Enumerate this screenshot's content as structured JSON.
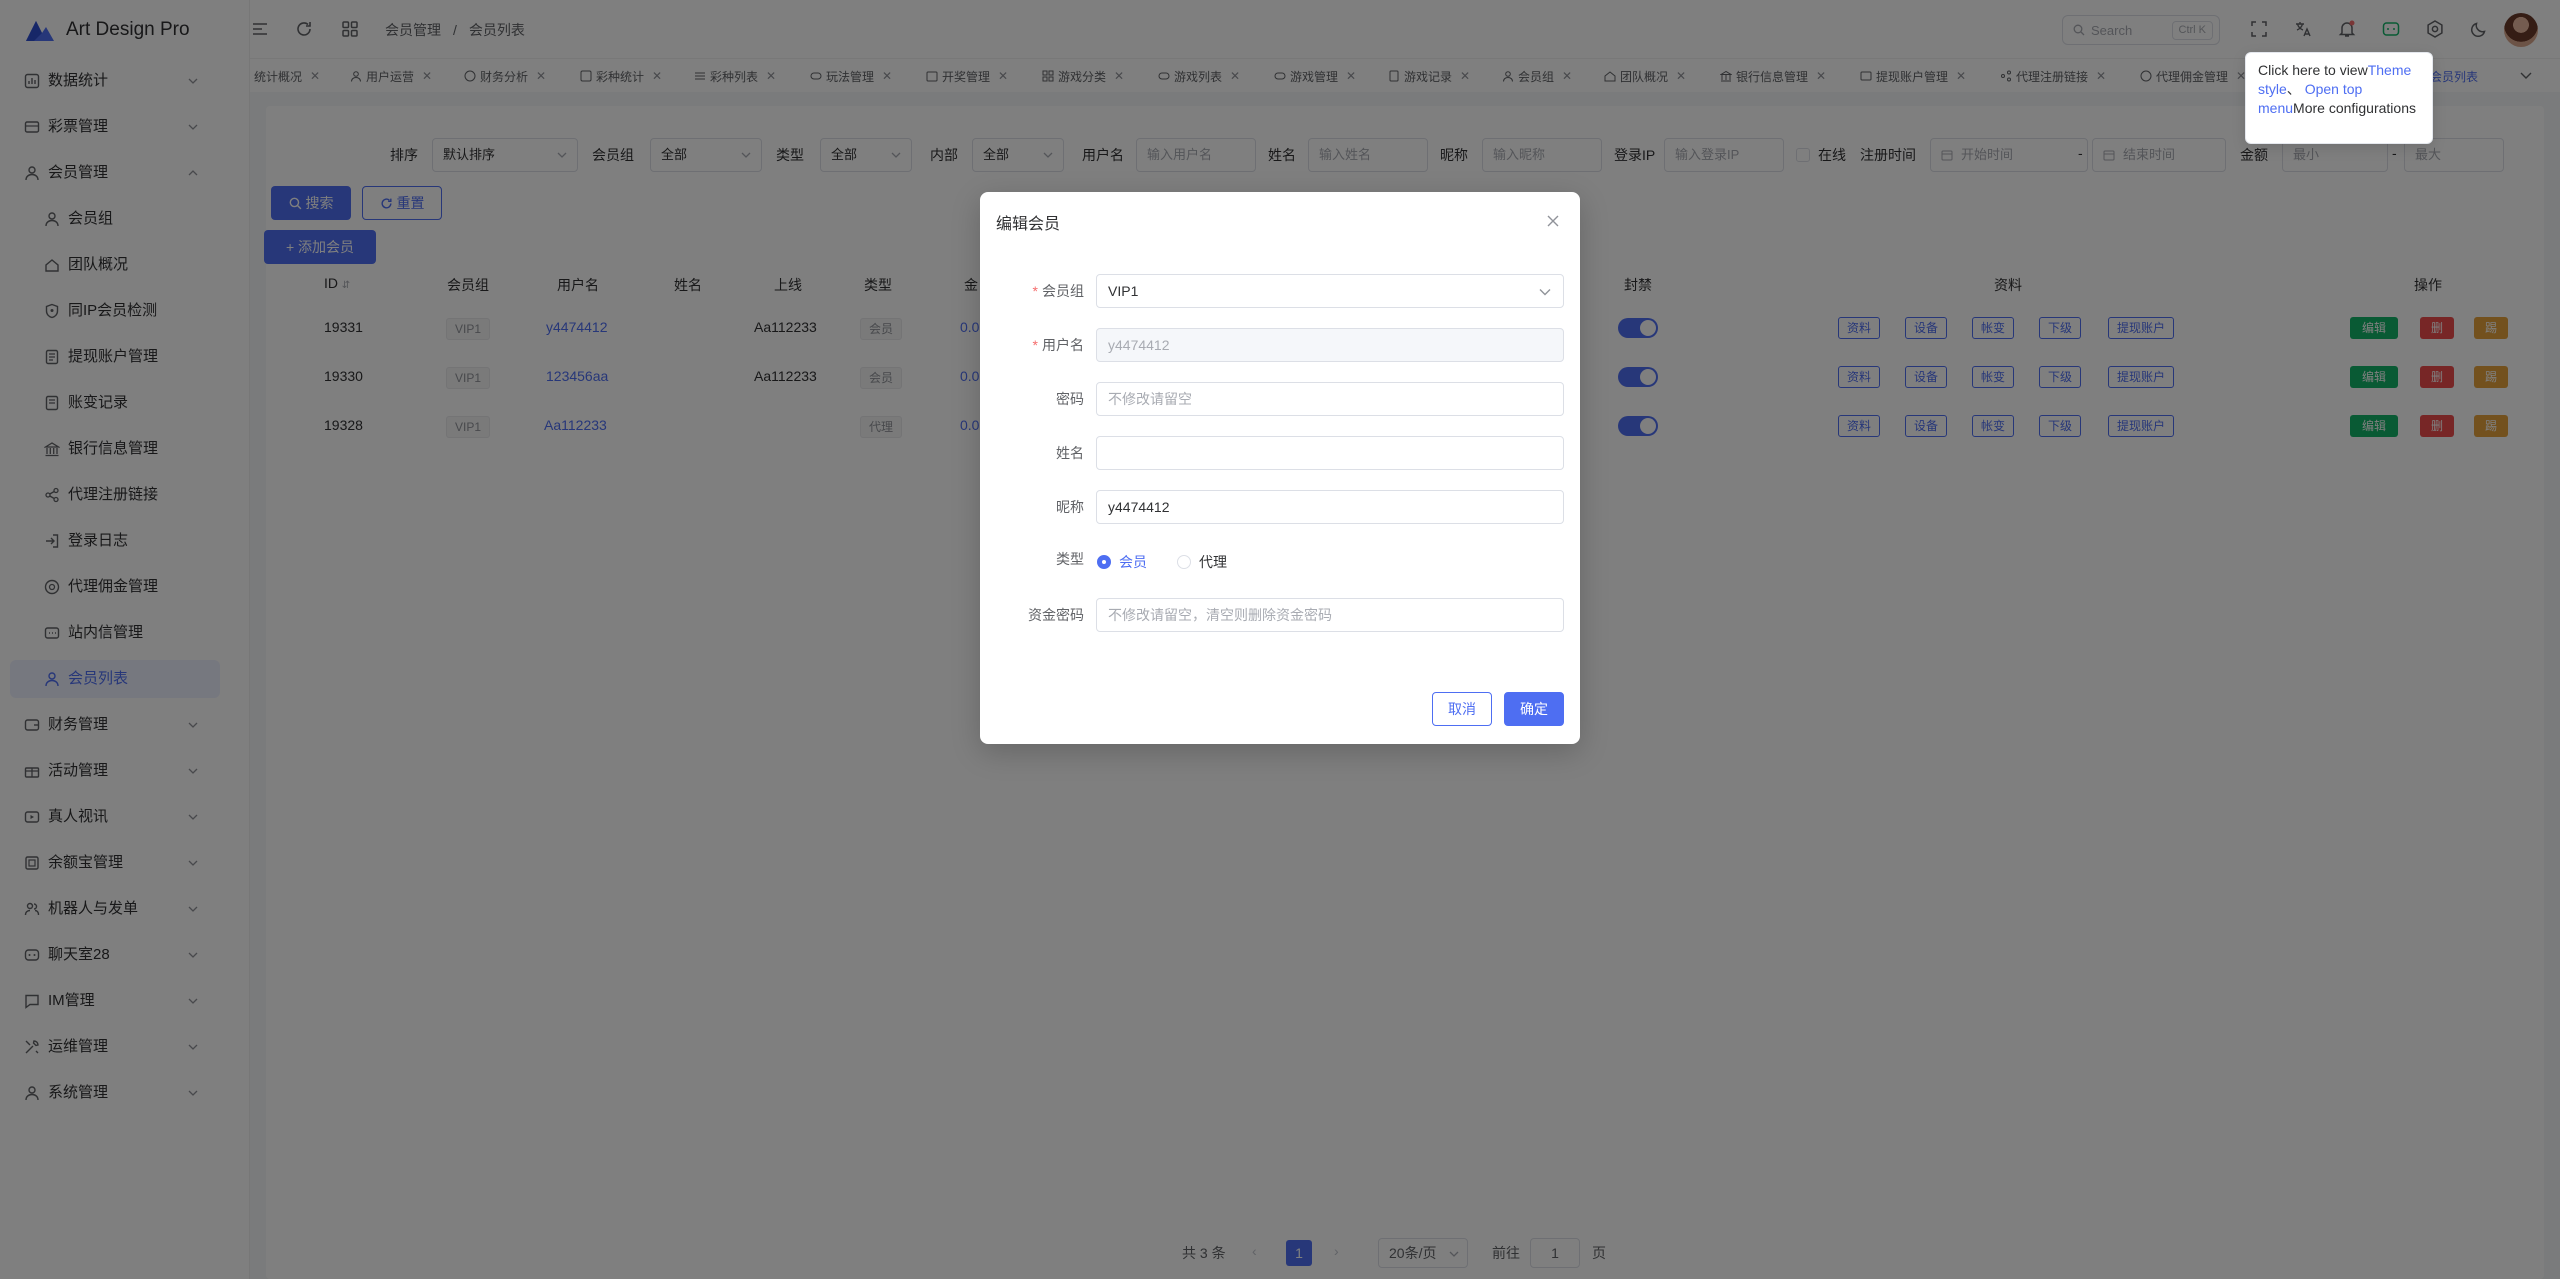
{
  "app": {
    "title": "Art Design Pro"
  },
  "sidebar": {
    "items": [
      {
        "label": "数据统计",
        "icon": "chart-icon"
      },
      {
        "label": "彩票管理",
        "icon": "ticket-icon"
      },
      {
        "label": "会员管理",
        "icon": "user-icon"
      },
      {
        "label": "会员组",
        "icon": "user-icon"
      },
      {
        "label": "团队概况",
        "icon": "team-icon"
      },
      {
        "label": "同IP会员检测",
        "icon": "shield-icon"
      },
      {
        "label": "提现账户管理",
        "icon": "doc-icon"
      },
      {
        "label": "账变记录",
        "icon": "doc-icon"
      },
      {
        "label": "银行信息管理",
        "icon": "bank-icon"
      },
      {
        "label": "代理注册链接",
        "icon": "share-icon"
      },
      {
        "label": "登录日志",
        "icon": "login-icon"
      },
      {
        "label": "代理佣金管理",
        "icon": "coin-icon"
      },
      {
        "label": "站内信管理",
        "icon": "message-icon"
      },
      {
        "label": "会员列表",
        "icon": "user-icon"
      },
      {
        "label": "财务管理",
        "icon": "wallet-icon"
      },
      {
        "label": "活动管理",
        "icon": "gift-icon"
      },
      {
        "label": "真人视讯",
        "icon": "video-icon"
      },
      {
        "label": "余额宝管理",
        "icon": "safe-icon"
      },
      {
        "label": "机器人与发单",
        "icon": "robot-icon"
      },
      {
        "label": "聊天室28",
        "icon": "chat-icon"
      },
      {
        "label": "IM管理",
        "icon": "chat-icon"
      },
      {
        "label": "运维管理",
        "icon": "tool-icon"
      },
      {
        "label": "系统管理",
        "icon": "user-icon"
      }
    ]
  },
  "header": {
    "breadcrumb": [
      "会员管理",
      "/",
      "会员列表"
    ],
    "search_placeholder": "Search",
    "search_shortcut": "Ctrl K"
  },
  "tabs": [
    "统计概况",
    "用户运营",
    "财务分析",
    "彩种统计",
    "彩种列表",
    "玩法管理",
    "开奖管理",
    "游戏分类",
    "游戏列表",
    "游戏管理",
    "游戏记录",
    "会员组",
    "团队概况",
    "银行信息管理",
    "提现账户管理",
    "代理注册链接",
    "代理佣金管理",
    "会员列表"
  ],
  "tooltip": {
    "prefix": "Click here to view",
    "link1": "Theme style",
    "sep": "、",
    "link2": "Open top menu",
    "suffix": "More configurations"
  },
  "filters": {
    "add_member": "+ 添加会员",
    "sort_label": "排序",
    "sort_value": "默认排序",
    "group_label": "会员组",
    "group_value": "全部",
    "type_label": "类型",
    "type_value": "全部",
    "internal_label": "内部",
    "internal_value": "全部",
    "username_label": "用户名",
    "username_ph": "输入用户名",
    "name_label": "姓名",
    "name_ph": "输入姓名",
    "nick_label": "昵称",
    "nick_ph": "输入昵称",
    "ip_label": "登录IP",
    "ip_ph": "输入登录IP",
    "online_label": "在线",
    "regtime_label": "注册时间",
    "start_ph": "开始时间",
    "dash": "-",
    "end_ph": "结束时间",
    "amount_label": "金额",
    "min_ph": "最小",
    "max_ph": "最大",
    "search_btn": "搜索",
    "reset_btn": "重置"
  },
  "table": {
    "headers": [
      "ID",
      "会员组",
      "用户名",
      "姓名",
      "上线",
      "类型",
      "金",
      "封禁",
      "资料",
      "操作"
    ],
    "rows": [
      {
        "id": "19331",
        "group": "VIP1",
        "username": "y4474412",
        "upline": "Aa112233",
        "type": "会员",
        "amount": "0.0"
      },
      {
        "id": "19330",
        "group": "VIP1",
        "username": "123456aa",
        "upline": "Aa112233",
        "type": "会员",
        "amount": "0.0"
      },
      {
        "id": "19328",
        "group": "VIP1",
        "username": "Aa112233",
        "upline": "",
        "type": "代理",
        "amount": "0.0"
      }
    ],
    "info_buttons": [
      "资料",
      "设备",
      "帐变",
      "下级",
      "提现账户"
    ],
    "action_buttons": [
      "编辑",
      "删",
      "踢"
    ]
  },
  "pagination": {
    "total": "共 3 条",
    "current": "1",
    "page_size": "20条/页",
    "goto_label": "前往",
    "goto_value": "1",
    "page_suffix": "页"
  },
  "dialog": {
    "title": "编辑会员",
    "group_label": "会员组",
    "group_value": "VIP1",
    "username_label": "用户名",
    "username_value": "y4474412",
    "password_label": "密码",
    "password_ph": "不修改请留空",
    "name_label": "姓名",
    "nick_label": "昵称",
    "nick_value": "y4474412",
    "type_label": "类型",
    "type_member": "会员",
    "type_agent": "代理",
    "fundpwd_label": "资金密码",
    "fundpwd_ph": "不修改请留空，清空则删除资金密码",
    "cancel": "取消",
    "confirm": "确定"
  },
  "colors": {
    "primary": "#4e6ef2",
    "success": "#13b569",
    "danger": "#ef4d4d",
    "warning": "#e6a23c"
  }
}
